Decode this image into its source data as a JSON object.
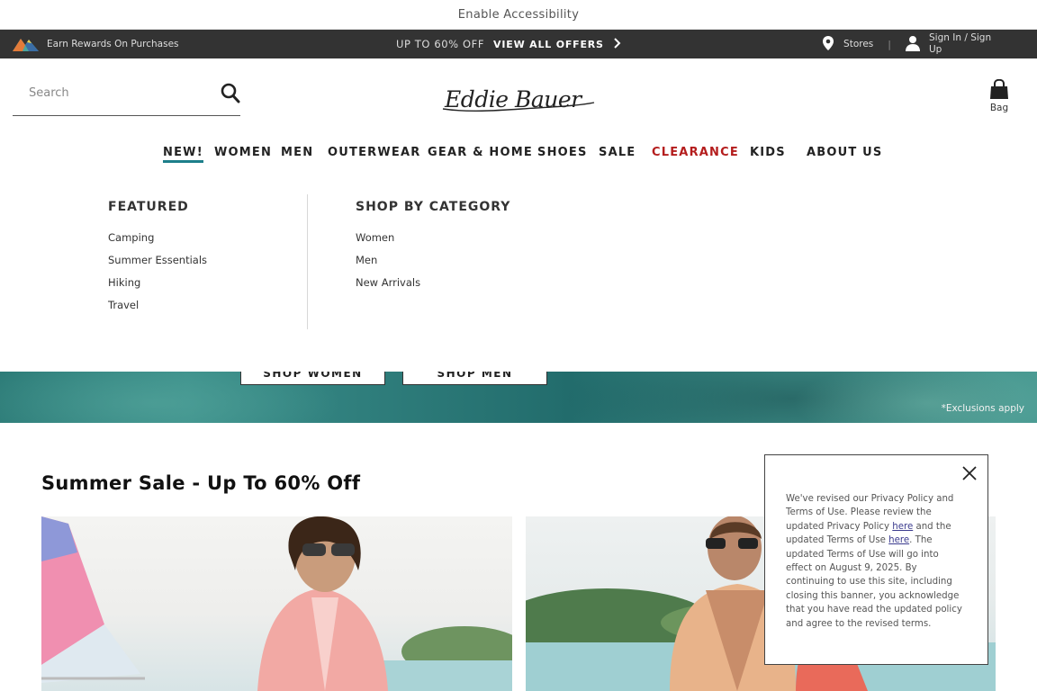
{
  "accessibility": {
    "label": "Enable Accessibility"
  },
  "promo": {
    "rewards": "Earn Rewards On Purchases",
    "offer": "UP TO 60% OFF",
    "view_all": "VIEW ALL OFFERS",
    "stores": "Stores",
    "sign_in": "Sign In / Sign Up"
  },
  "header": {
    "search_placeholder": "Search",
    "logo_text": "Eddie Bauer",
    "bag_label": "Bag"
  },
  "nav": {
    "new": "NEW!",
    "women": "WOMEN",
    "men": "MEN",
    "outerwear": "OUTERWEAR",
    "gear_home": "GEAR & HOME",
    "shoes": "SHOES",
    "sale": "SALE",
    "clearance": "CLEARANCE",
    "kids": "KIDS",
    "about": "ABOUT US"
  },
  "mega_menu": {
    "featured": {
      "heading": "FEATURED",
      "links": [
        "Camping",
        "Summer Essentials",
        "Hiking",
        "Travel"
      ]
    },
    "category": {
      "heading": "SHOP BY CATEGORY",
      "links": [
        "Women",
        "Men",
        "New Arrivals"
      ]
    }
  },
  "hero": {
    "shop_women": "SHOP WOMEN",
    "shop_men": "SHOP MEN",
    "exclusions": "*Exclusions apply"
  },
  "section": {
    "title": "Summer Sale - Up To 60% Off"
  },
  "privacy": {
    "p1": "We've revised our Privacy Policy and Terms of Use. Please review the updated Privacy Policy ",
    "link1": "here",
    "p2": " and the updated Terms of Use ",
    "link2": "here",
    "p3": ". The updated Terms of Use will go into effect on August 9, 2025. By continuing to use this site, including closing this banner, you acknowledge that you have read the updated policy and agree to the revised terms."
  },
  "colors": {
    "promo_bar": "#333333",
    "accent_teal": "#1d7f8a",
    "clearance_red": "#b41d1d",
    "link_purple": "#3b3b8e"
  },
  "icons": [
    "mountain-logo-icon",
    "location-pin-icon",
    "user-icon",
    "chevron-right-icon",
    "search-icon",
    "bag-icon",
    "close-icon"
  ]
}
